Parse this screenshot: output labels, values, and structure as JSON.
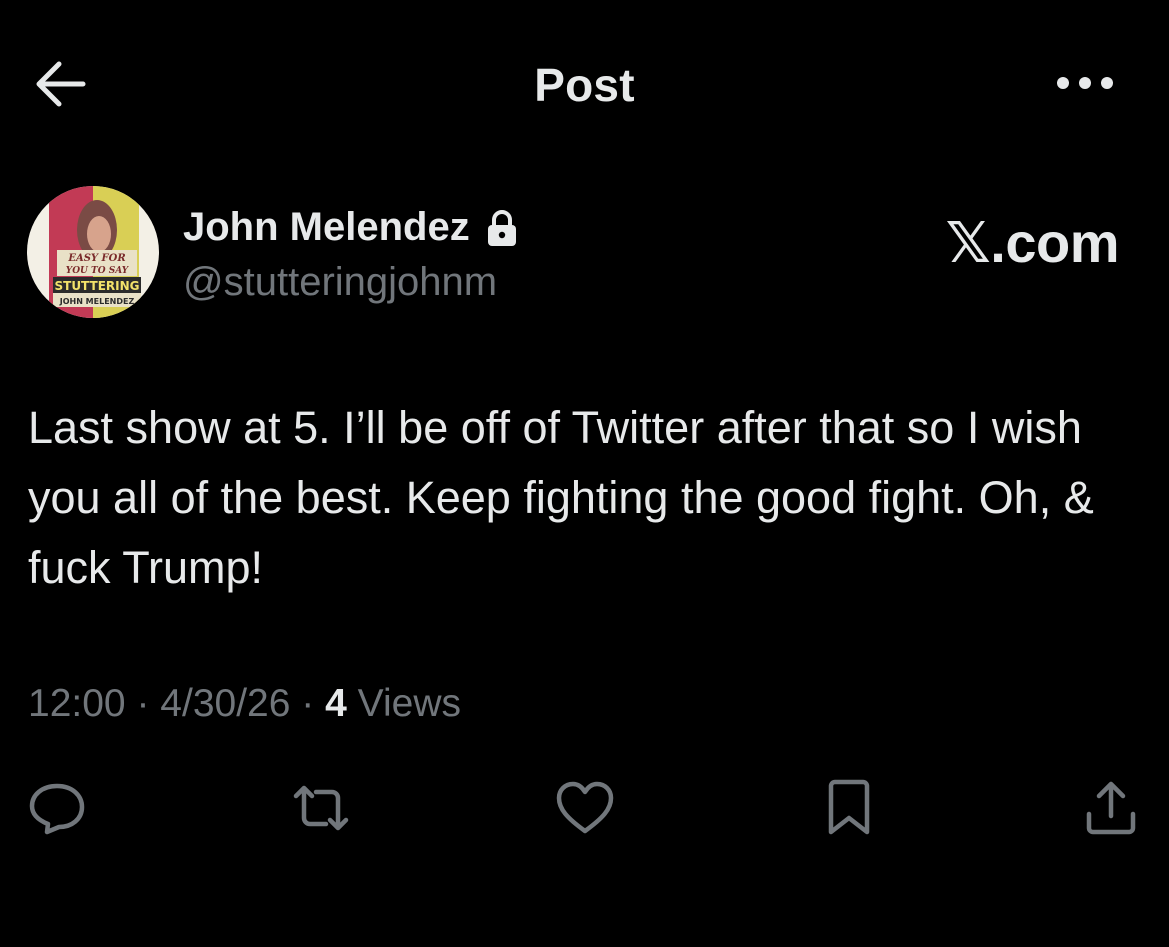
{
  "header": {
    "title": "Post",
    "back_icon": "arrow-left-icon",
    "more_icon": "more-horizontal-icon"
  },
  "author": {
    "display_name": "John Melendez",
    "handle": "@stutteringjohnm",
    "protected": true,
    "avatar_text": {
      "line1": "EASY FOR",
      "line2": "YOU TO SAY",
      "line3": "STUTTERING",
      "line4": "JOHN MELENDEZ"
    }
  },
  "brand": "𝕏.com",
  "tweet": {
    "text": "Last show at 5. I’ll be off of Twitter after that so I wish you all of the best. Keep fighting the good fight. Oh, & fuck Trump!",
    "time": "12:00",
    "date": "4/30/26",
    "views_count": "4",
    "views_label": "Views",
    "separator": "·"
  },
  "actions": {
    "icons": [
      "reply-icon",
      "retweet-icon",
      "like-icon",
      "bookmark-icon",
      "share-icon"
    ]
  },
  "colors": {
    "background": "#000000",
    "text_primary": "#e7e9ea",
    "text_secondary": "#71767b"
  }
}
